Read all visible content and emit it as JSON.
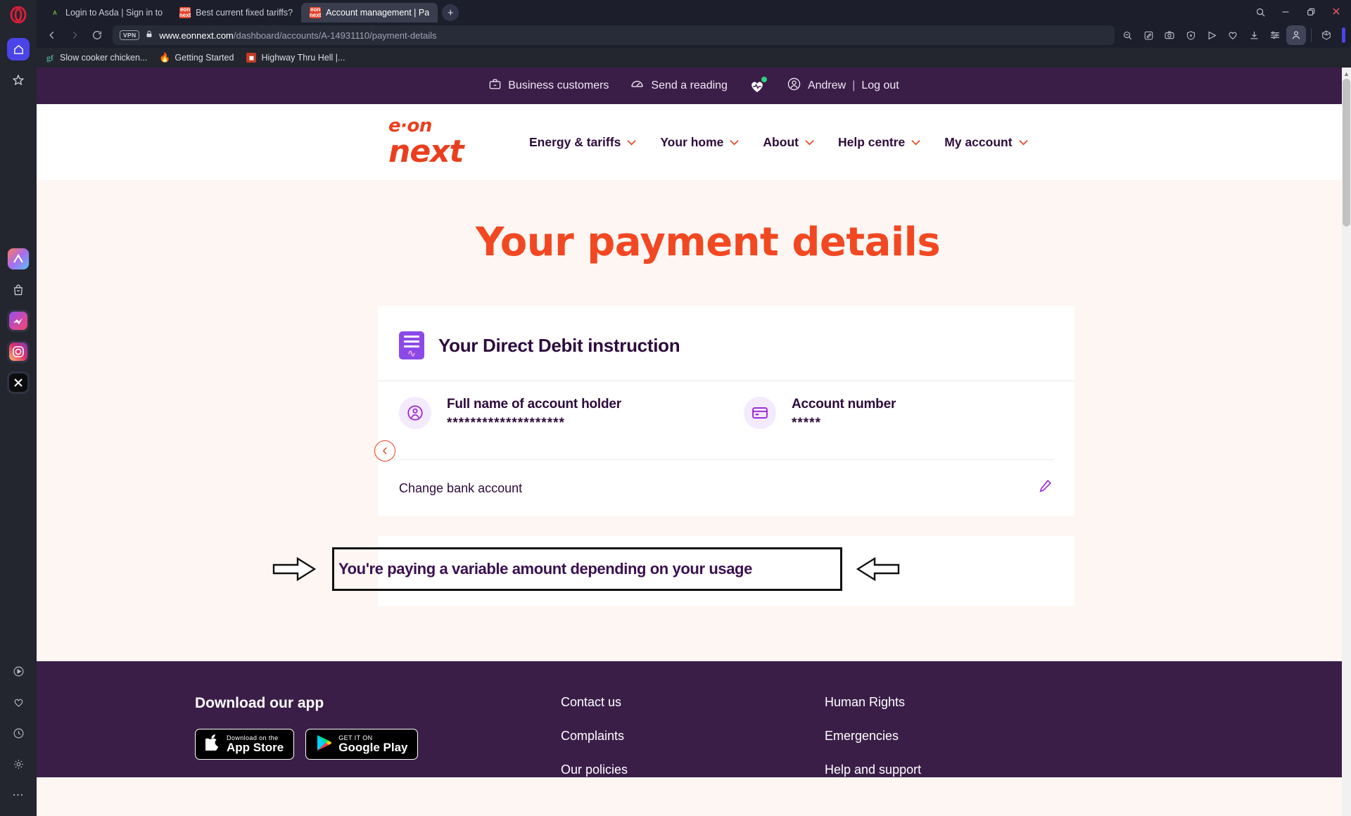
{
  "browser": {
    "tabs": [
      {
        "title": "Login to Asda | Sign in to",
        "favicon": "asda-icon",
        "active": false
      },
      {
        "title": "Best current fixed tariffs?",
        "favicon": "eon-next-icon",
        "active": false
      },
      {
        "title": "Account management | Pa",
        "favicon": "eon-next-icon",
        "active": true
      }
    ],
    "new_tab_label": "+",
    "window_controls": {
      "search": "search-icon",
      "minimize": "–",
      "maximize": "❐",
      "close": "✕"
    },
    "nav": {
      "back": "‹",
      "forward": "›",
      "reload": "↻"
    },
    "address": {
      "vpn_badge": "VPN",
      "lock": "lock-icon",
      "domain": "www.eonnext.com",
      "path": "/dashboard/accounts/A-14931110/payment-details"
    },
    "toolbar_icons": [
      "zoom-out-icon",
      "edit-snapshot-icon",
      "camera-icon",
      "shield-icon",
      "player-icon",
      "heart-icon",
      "download-icon",
      "easy-setup-icon",
      "profile-icon",
      "workspaces-icon"
    ],
    "bookmarks": [
      {
        "label": "Slow cooker chicken...",
        "icon": "google-docs-icon"
      },
      {
        "label": "Getting Started",
        "icon": "firefox-icon"
      },
      {
        "label": "Highway Thru Hell |...",
        "icon": "video-icon"
      }
    ],
    "sidebar_icons": [
      "opera-logo-icon",
      "home-icon",
      "bookmarks-star-icon",
      "aria-ai-icon",
      "shopping-bag-icon",
      "messenger-icon",
      "instagram-icon",
      "x-twitter-icon",
      "player-icon",
      "heart-icon",
      "history-icon",
      "settings-icon",
      "more-icon"
    ]
  },
  "site": {
    "utility_bar": {
      "business": {
        "label": "Business customers",
        "icon": "briefcase-icon"
      },
      "reading": {
        "label": "Send a reading",
        "icon": "meter-icon"
      },
      "heart": {
        "icon": "heart-badge-icon"
      },
      "user": {
        "name": "Andrew",
        "icon": "user-circle-icon"
      },
      "separator": "|",
      "logout": "Log out"
    },
    "brand": {
      "line1": "e·on",
      "line2": "next"
    },
    "nav_items": [
      {
        "label": "Energy & tariffs",
        "chevron": "⌄"
      },
      {
        "label": "Your home",
        "chevron": "⌄"
      },
      {
        "label": "About",
        "chevron": "⌄"
      },
      {
        "label": "Help centre",
        "chevron": "⌄"
      },
      {
        "label": "My account",
        "chevron": "⌄"
      }
    ],
    "page": {
      "back_icon": "chevron-left-icon",
      "title": "Your payment details"
    },
    "dd_card": {
      "icon": "direct-debit-icon",
      "title": "Your Direct Debit instruction",
      "fields": [
        {
          "icon": "person-icon",
          "label": "Full name of account holder",
          "value": "********************"
        },
        {
          "icon": "card-icon",
          "label": "Account number",
          "value": "*****"
        }
      ],
      "change_row": {
        "label": "Change bank account",
        "icon": "pencil-icon"
      }
    },
    "annotation": {
      "text": "You're paying a variable amount depending on your usage",
      "left_arrow": "arrow-right-pointer",
      "right_arrow": "arrow-left-pointer"
    },
    "footer": {
      "app_title": "Download our app",
      "stores": [
        {
          "sub": "Download on the",
          "main": "App Store",
          "icon": "apple-icon"
        },
        {
          "sub": "GET IT ON",
          "main": "Google Play",
          "icon": "google-play-icon"
        }
      ],
      "columns": [
        [
          "Contact us",
          "Complaints",
          "Our policies"
        ],
        [
          "Human Rights",
          "Emergencies",
          "Help and support"
        ]
      ]
    }
  },
  "colors": {
    "brand_orange": "#ea3f1e",
    "title_orange": "#f24822",
    "deep_purple": "#3a1e48",
    "icon_purple": "#9a22d6",
    "page_bg": "#fdf6f2",
    "accent_blue": "#4b44e8"
  }
}
